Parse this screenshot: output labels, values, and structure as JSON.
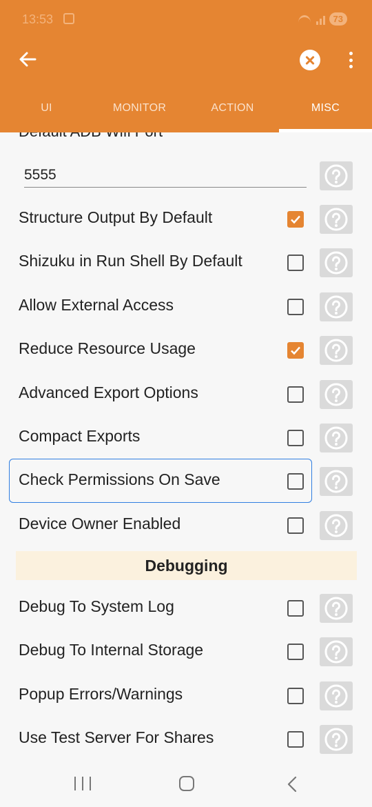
{
  "status_bar": {
    "time": "13:53",
    "battery": "73"
  },
  "tabs": [
    {
      "label": "UI",
      "active": false
    },
    {
      "label": "MONITOR",
      "active": false
    },
    {
      "label": "ACTION",
      "active": false
    },
    {
      "label": "MISC",
      "active": true
    }
  ],
  "partial_label": "Default ADB Wifi Port",
  "adb_port_value": "5555",
  "settings": [
    {
      "label": "Structure Output By Default",
      "checked": true
    },
    {
      "label": "Shizuku in Run Shell By Default",
      "checked": false
    },
    {
      "label": "Allow External Access",
      "checked": false
    },
    {
      "label": "Reduce Resource Usage",
      "checked": true
    },
    {
      "label": "Advanced Export Options",
      "checked": false
    },
    {
      "label": "Compact Exports",
      "checked": false
    },
    {
      "label": "Check Permissions On Save",
      "checked": false
    },
    {
      "label": "Device Owner Enabled",
      "checked": false
    }
  ],
  "debugging_section": "Debugging",
  "debug_settings": [
    {
      "label": "Debug To System Log",
      "checked": false
    },
    {
      "label": "Debug To Internal Storage",
      "checked": false
    },
    {
      "label": "Popup Errors/Warnings",
      "checked": false
    },
    {
      "label": "Use Test Server For Shares",
      "checked": false
    }
  ],
  "colors": {
    "accent": "#E58532",
    "section_bg": "#fbf1de",
    "focus": "#2f7de1"
  }
}
